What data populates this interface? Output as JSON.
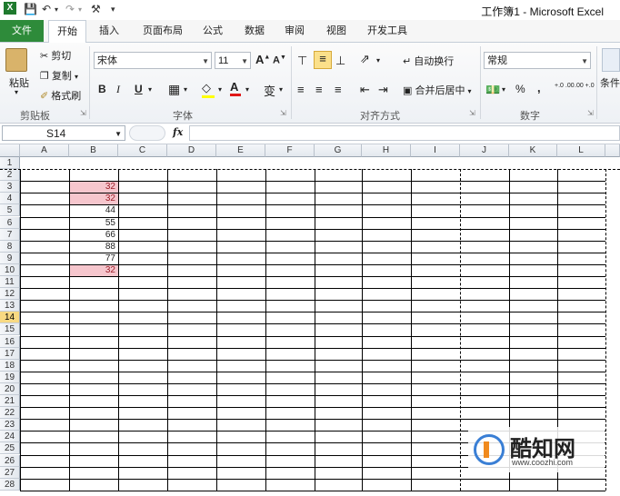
{
  "titlebar": {
    "app_title": "工作簿1 - Microsoft Excel",
    "quick_access": [
      "save-icon",
      "undo-icon",
      "redo-icon",
      "customize-icon"
    ]
  },
  "tabs": [
    {
      "label": "文件",
      "name": "tab-file"
    },
    {
      "label": "开始",
      "name": "tab-home"
    },
    {
      "label": "插入",
      "name": "tab-insert"
    },
    {
      "label": "页面布局",
      "name": "tab-page-layout"
    },
    {
      "label": "公式",
      "name": "tab-formulas"
    },
    {
      "label": "数据",
      "name": "tab-data"
    },
    {
      "label": "审阅",
      "name": "tab-review"
    },
    {
      "label": "视图",
      "name": "tab-view"
    },
    {
      "label": "开发工具",
      "name": "tab-developer"
    }
  ],
  "ribbon": {
    "clipboard": {
      "paste": "粘贴",
      "cut": "剪切",
      "copy": "复制",
      "format_painter": "格式刷",
      "group": "剪贴板"
    },
    "font": {
      "name": "宋体",
      "size": "11",
      "group": "字体",
      "bold": "B",
      "italic": "I",
      "underline": "U",
      "grow": "A",
      "shrink": "A",
      "font_color": "A",
      "fill_glyph": "◇",
      "phonetic": "变"
    },
    "alignment": {
      "wrap": "自动换行",
      "merge": "合并后居中",
      "group": "对齐方式"
    },
    "number": {
      "format": "常规",
      "percent": "%",
      "comma": ",",
      "inc_decimal": "+.0 .00",
      "dec_decimal": ".00 +.0",
      "group": "数字"
    },
    "styles": {
      "conditional": "条件"
    }
  },
  "formula_bar": {
    "name_box": "S14",
    "fx": "fx",
    "value": ""
  },
  "grid": {
    "columns": [
      "A",
      "B",
      "C",
      "D",
      "E",
      "F",
      "G",
      "H",
      "I",
      "J",
      "K",
      "L"
    ],
    "rows": [
      "1",
      "2",
      "3",
      "4",
      "5",
      "6",
      "7",
      "8",
      "9",
      "10",
      "11",
      "12",
      "13",
      "14",
      "15",
      "16",
      "17",
      "18",
      "19",
      "20",
      "21",
      "22",
      "23",
      "24",
      "25",
      "26",
      "27",
      "28"
    ],
    "selected_row": "14",
    "b_values": {
      "3": "32",
      "4": "32",
      "5": "44",
      "6": "55",
      "7": "66",
      "8": "88",
      "9": "77",
      "10": "32"
    },
    "highlighted_rows": [
      "3",
      "4",
      "10"
    ],
    "highlight_color": "#f6c6cd"
  },
  "watermark": {
    "brand": "酷知网",
    "url": "www.coozhi.com"
  },
  "colors": {
    "file_tab": "#2e8b3a",
    "row_select": "#f8d982"
  }
}
